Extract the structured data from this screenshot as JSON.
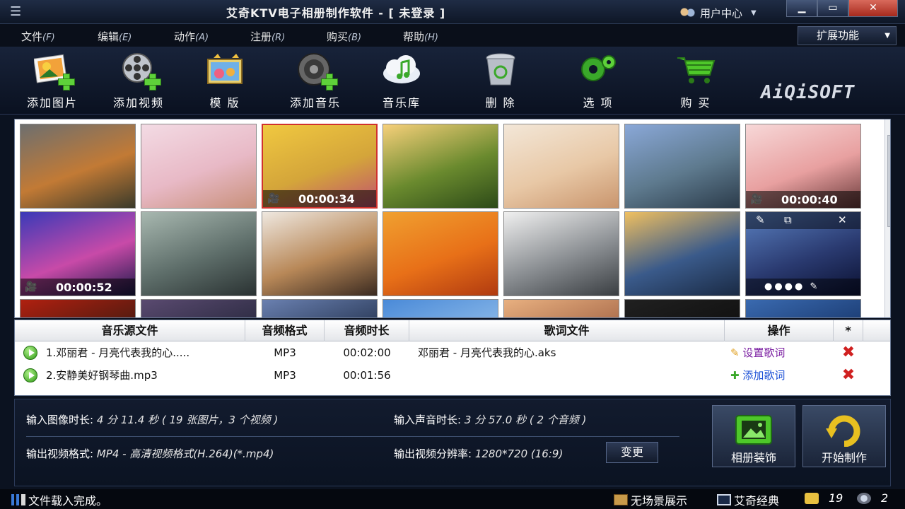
{
  "window": {
    "title": "艾奇KTV电子相册制作软件 - [ 未登录 ]",
    "user_center": "用户中心"
  },
  "menu": [
    {
      "label": "文件",
      "hotkey": "(F)"
    },
    {
      "label": "编辑",
      "hotkey": "(E)"
    },
    {
      "label": "动作",
      "hotkey": "(A)"
    },
    {
      "label": "注册",
      "hotkey": "(R)"
    },
    {
      "label": "购买",
      "hotkey": "(B)"
    },
    {
      "label": "帮助",
      "hotkey": "(H)"
    }
  ],
  "extend_label": "扩展功能",
  "toolbar": [
    {
      "label": "添加图片",
      "icon": "add-image-icon"
    },
    {
      "label": "添加视频",
      "icon": "add-video-icon"
    },
    {
      "label": "模 版",
      "icon": "template-icon"
    },
    {
      "label": "添加音乐",
      "icon": "add-music-icon"
    },
    {
      "label": "音乐库",
      "icon": "music-library-icon"
    },
    {
      "label": "删 除",
      "icon": "trash-icon"
    },
    {
      "label": "选 项",
      "icon": "gear-icon"
    },
    {
      "label": "购 买",
      "icon": "cart-icon"
    }
  ],
  "logo_text": "AiQiSOFT",
  "thumbnails": [
    {
      "kind": "image",
      "colors": [
        "#6d6f6f",
        "#c27a35",
        "#3a3a2a"
      ]
    },
    {
      "kind": "image",
      "colors": [
        "#f3dbe4",
        "#e8b9c6",
        "#c8907a"
      ]
    },
    {
      "kind": "video",
      "duration": "00:00:34",
      "colors": [
        "#f0c840",
        "#d4a53a",
        "#c05070"
      ]
    },
    {
      "kind": "image",
      "colors": [
        "#f7d07a",
        "#6a8a2e",
        "#2d4a18"
      ]
    },
    {
      "kind": "image",
      "colors": [
        "#f3e7d8",
        "#e8c8a6",
        "#c9956d"
      ]
    },
    {
      "kind": "image",
      "colors": [
        "#8aa8d8",
        "#5e7a8e",
        "#2b3b4a"
      ]
    },
    {
      "kind": "video",
      "duration": "00:00:40",
      "colors": [
        "#f7d8d8",
        "#e8a0a0",
        "#6a3a3a"
      ]
    },
    {
      "kind": "video",
      "duration": "00:00:52",
      "colors": [
        "#3a3ab8",
        "#c84aa8",
        "#1a1a4a"
      ]
    },
    {
      "kind": "image",
      "colors": [
        "#a8b8b0",
        "#5e6e6a",
        "#2a3232"
      ]
    },
    {
      "kind": "image",
      "colors": [
        "#efe8e0",
        "#b88858",
        "#3a2a20"
      ]
    },
    {
      "kind": "image",
      "colors": [
        "#f0a030",
        "#e87018",
        "#b03a10"
      ]
    },
    {
      "kind": "image",
      "colors": [
        "#f0f0f0",
        "#8a8e92",
        "#3a3e42"
      ]
    },
    {
      "kind": "image",
      "colors": [
        "#f0c060",
        "#3a5a8a",
        "#1a2a44"
      ]
    },
    {
      "kind": "image-selected",
      "colors": [
        "#5a80c0",
        "#2a3a70",
        "#0a1030"
      ]
    },
    {
      "kind": "image",
      "colors": [
        "#b02010",
        "#4a1a10",
        "#201008"
      ]
    },
    {
      "kind": "image",
      "colors": [
        "#5a4a70",
        "#2a2a40",
        "#101020"
      ]
    },
    {
      "kind": "image",
      "colors": [
        "#6a80b0",
        "#2a3a58",
        "#101830"
      ]
    },
    {
      "kind": "image",
      "colors": [
        "#4a8ad8",
        "#8ab8e8",
        "#f0f0f0"
      ]
    },
    {
      "kind": "image",
      "colors": [
        "#e8b080",
        "#a86a4a",
        "#402a20"
      ]
    },
    {
      "kind": "image",
      "colors": [
        "#202020",
        "#101010",
        "#000000"
      ]
    },
    {
      "kind": "image",
      "colors": [
        "#3a6ab0",
        "#1a3a70",
        "#0a1a40"
      ]
    }
  ],
  "music_table": {
    "headers": [
      "音乐源文件",
      "音频格式",
      "音频时长",
      "歌词文件",
      "操作",
      "*"
    ],
    "rows": [
      {
        "name": "1.邓丽君 - 月亮代表我的心.....",
        "format": "MP3",
        "duration": "00:02:00",
        "lyric": "邓丽君 - 月亮代表我的心.aks",
        "action": "设置歌词"
      },
      {
        "name": "2.安静美好钢琴曲.mp3",
        "format": "MP3",
        "duration": "00:01:56",
        "lyric": "",
        "action": "添加歌词"
      }
    ]
  },
  "info": {
    "image_duration_label": "输入图像时长:",
    "image_duration_value": " 4 分 11.4 秒 ( 19 张图片，3 个视频 )",
    "audio_duration_label": "输入声音时长:",
    "audio_duration_value": " 3 分 57.0 秒 ( 2 个音频 )",
    "output_format_label": "输出视频格式:",
    "output_format_value": " MP4 - 高清视频格式(H.264)(*.mp4)",
    "output_res_label": "输出视频分辨率:",
    "output_res_value": " 1280*720 (16:9)",
    "change_button": "变更",
    "decorate_button": "相册装饰",
    "start_button": "开始制作"
  },
  "status": {
    "message": "文件载入完成。",
    "scene": "无场景展示",
    "theme": "艾奇经典",
    "image_count": "19",
    "video_count": "2"
  }
}
